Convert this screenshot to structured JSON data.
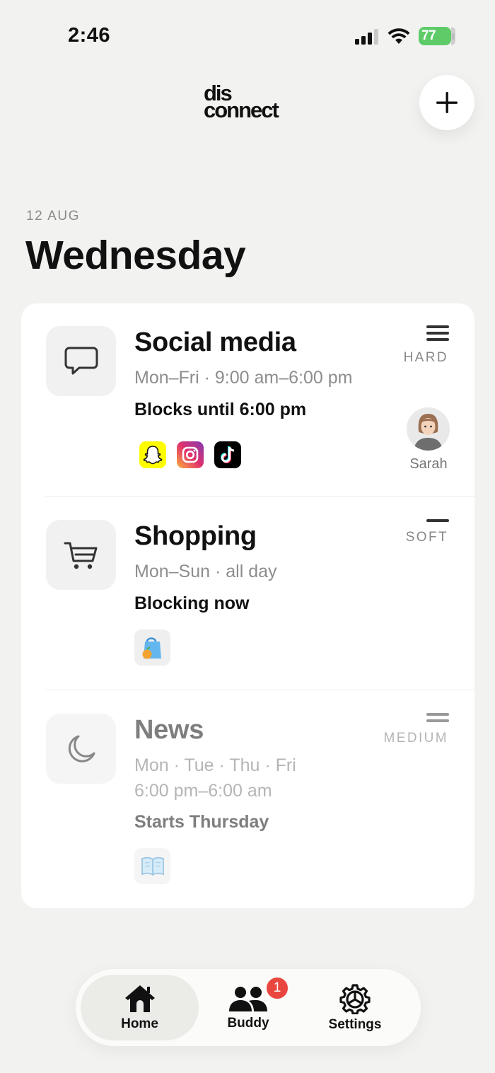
{
  "status_bar": {
    "time": "2:46",
    "battery": "77"
  },
  "header": {
    "logo_line1": "dis",
    "logo_line2": "connect",
    "add_icon": "plus-icon"
  },
  "date": {
    "label": "12 AUG",
    "weekday": "Wednesday"
  },
  "schedules": [
    {
      "title": "Social media",
      "schedule": "Mon–Fri · 9:00 am–6:00 pm",
      "status": "Blocks until 6:00 pm",
      "level": "HARD",
      "icon": "chat-bubble-icon",
      "apps": [
        "snapchat-icon",
        "instagram-icon",
        "tiktok-icon"
      ],
      "buddy": "Sarah"
    },
    {
      "title": "Shopping",
      "schedule": "Mon–Sun · all day",
      "status": "Blocking now",
      "level": "SOFT",
      "icon": "cart-icon",
      "apps": [
        "shopping-bag-icon"
      ]
    },
    {
      "title": "News",
      "schedule_line1": "Mon · Tue · Thu · Fri",
      "schedule_line2": "6:00 pm–6:00 am",
      "status": "Starts Thursday",
      "level": "MEDIUM",
      "icon": "moon-icon",
      "apps": [
        "book-icon"
      ]
    }
  ],
  "tabs": [
    {
      "label": "Home",
      "icon": "home-icon",
      "active": true
    },
    {
      "label": "Buddy",
      "icon": "people-icon",
      "badge": "1"
    },
    {
      "label": "Settings",
      "icon": "gear-icon"
    }
  ],
  "colors": {
    "background": "#f2f2f0",
    "badge": "#e8463e",
    "battery": "#5ecb68"
  }
}
